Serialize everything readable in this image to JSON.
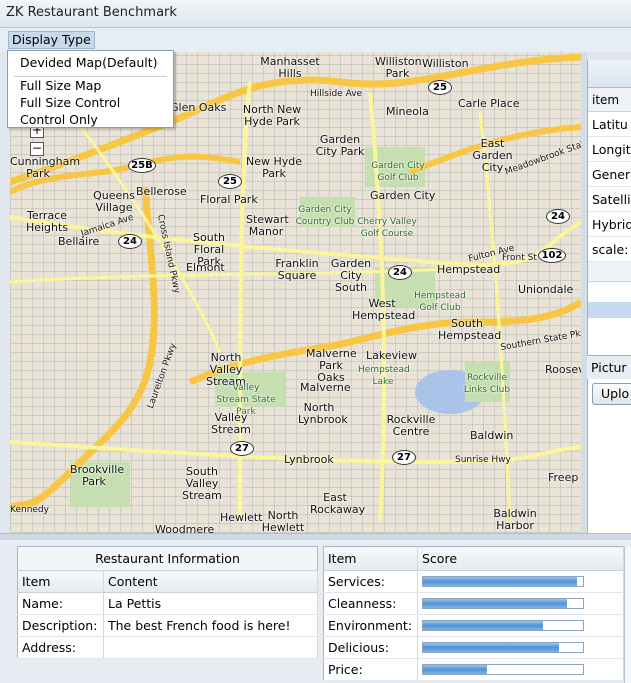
{
  "window": {
    "title": "ZK Restaurant Benchmark"
  },
  "menu": {
    "label": "Display Type",
    "items": [
      "Devided Map(Default)",
      "Full Size Map",
      "Full Size Control",
      "Control Only"
    ]
  },
  "map": {
    "zoom_in": "+",
    "zoom_out": "−",
    "places": [
      "Manhasset Hills",
      "Williston Park",
      "Williston",
      "Glen Oaks",
      "North New Hyde Park",
      "Mineola",
      "Carle Place",
      "Cunningham Park",
      "New Hyde Park",
      "Garden City Park",
      "East Garden City",
      "Queens Village",
      "Bellerose",
      "Floral Park",
      "Garden City",
      "Terrace Heights",
      "Stewart Manor",
      "Bellaire",
      "South Floral Park",
      "Elmont",
      "Franklin Square",
      "Garden City South",
      "Hempstead",
      "Uniondale",
      "West Hempstead",
      "South Hempstead",
      "North Valley Stream",
      "Malverne Park Oaks",
      "Lakeview",
      "Malverne",
      "Valley Stream",
      "North Lynbrook",
      "Rockville Centre",
      "Baldwin",
      "Freep",
      "Brookville Park",
      "South Valley Stream",
      "Lynbrook",
      "East Rockaway",
      "Hewlett",
      "North Hewlett",
      "Woodmere",
      "Baldwin Harbor",
      "Roosev"
    ],
    "park_labels": [
      "Garden City Golf Club",
      "Garden City Country Club",
      "Cherry Valley Golf Course",
      "Hempstead Golf Club",
      "Hempstead Lake",
      "Rockville Links Club",
      "Valley Stream State Park"
    ],
    "road_labels": [
      "Hillside Ave",
      "Jamaica Ave",
      "Cross Island Pkwy",
      "Laurelton Pkwy",
      "Fulton Ave",
      "Front St",
      "Southern State Pkwy",
      "Sunrise Hwy",
      "Meadowbrook State Pkwy",
      "Kennedy"
    ],
    "shields": [
      "25",
      "25B",
      "25",
      "24",
      "24",
      "24",
      "102",
      "27",
      "27"
    ]
  },
  "right_panel": {
    "column": "item",
    "rows": [
      "Latitu",
      "Longit",
      "Genera",
      "Satelli",
      "Hybrid",
      "scale:"
    ],
    "picture_label": "Pictur",
    "upload_label": "Uplo"
  },
  "restaurant_info": {
    "caption": "Restaurant Information",
    "columns": [
      "Item",
      "Content"
    ],
    "rows": [
      {
        "item": "Name:",
        "content": "La Pettis"
      },
      {
        "item": "Description:",
        "content": "The best French food is here!"
      },
      {
        "item": "Address:",
        "content": ""
      }
    ]
  },
  "scores": {
    "columns": [
      "Item",
      "Score"
    ],
    "rows": [
      {
        "item": "Services:",
        "value": 0.96
      },
      {
        "item": "Cleanness:",
        "value": 0.9
      },
      {
        "item": "Environment:",
        "value": 0.75
      },
      {
        "item": "Delicious:",
        "value": 0.85
      },
      {
        "item": "Price:",
        "value": 0.4
      }
    ]
  },
  "colors": {
    "highway": "#f7c744",
    "major_road": "#fcf59a",
    "water": "#a9c4e8",
    "park": "#c6dfb0",
    "bar_fill": "#4f93d6"
  }
}
